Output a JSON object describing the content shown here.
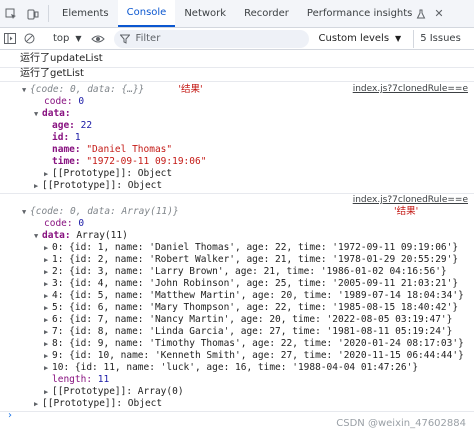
{
  "tabs": [
    {
      "label": "Elements"
    },
    {
      "label": "Console"
    },
    {
      "label": "Network"
    },
    {
      "label": "Recorder"
    },
    {
      "label": "Performance insights"
    }
  ],
  "toolbar": {
    "context": "top",
    "filter_placeholder": "Filter",
    "levels": "Custom levels",
    "issues": "5 Issues"
  },
  "logs": {
    "line1": "运行了updateList",
    "line2": "运行了getList"
  },
  "obj1": {
    "summary": "{code: 0, data: {…}}",
    "tag": "'结果'",
    "link": "index.js?7clonedRule==e",
    "code": "0",
    "age": "22",
    "id": "1",
    "name": "\"Daniel Thomas\"",
    "time": "\"1972-09-11 09:19:06\"",
    "proto1": "[[Prototype]]: Object",
    "proto2": "[[Prototype]]: Object"
  },
  "obj2": {
    "summary": "{code: 0, data: Array(11)}",
    "tag": "'结果'",
    "link": "index.js?7clonedRule==e",
    "code": "0",
    "data_type": "Array(11)",
    "items": [
      "0: {id: 1, name: 'Daniel Thomas', age: 22, time: '1972-09-11 09:19:06'}",
      "1: {id: 2, name: 'Robert Walker', age: 21, time: '1978-01-29 20:55:29'}",
      "2: {id: 3, name: 'Larry Brown', age: 21, time: '1986-01-02 04:16:56'}",
      "3: {id: 4, name: 'John Robinson', age: 25, time: '2005-09-11 21:03:21'}",
      "4: {id: 5, name: 'Matthew Martin', age: 20, time: '1989-07-14 18:04:34'}",
      "5: {id: 6, name: 'Mary Thompson', age: 22, time: '1985-08-15 18:40:42'}",
      "6: {id: 7, name: 'Nancy Martin', age: 20, time: '2022-08-05 03:19:47'}",
      "7: {id: 8, name: 'Linda Garcia', age: 27, time: '1981-08-11 05:19:24'}",
      "8: {id: 9, name: 'Timothy Thomas', age: 22, time: '2020-01-24 08:17:03'}",
      "9: {id: 10, name: 'Kenneth Smith', age: 27, time: '2020-11-15 06:44:44'}",
      "10: {id: 11, name: 'luck', age: 16, time: '1988-04-04 01:47:26'}"
    ],
    "length": "11",
    "proto_arr": "[[Prototype]]: Array(0)",
    "proto_obj": "[[Prototype]]: Object"
  },
  "watermark": "CSDN @weixin_47602884"
}
